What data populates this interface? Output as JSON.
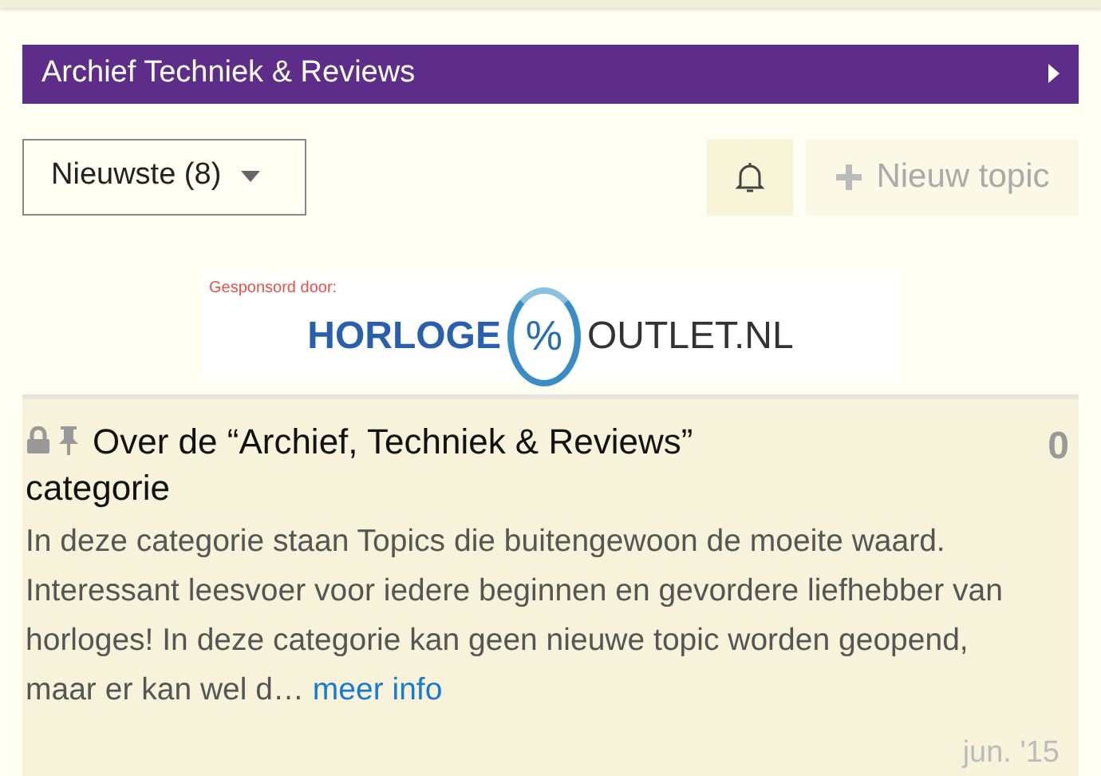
{
  "category_bar": {
    "title": "Archief Techniek & Reviews"
  },
  "toolbar": {
    "sort_dropdown": {
      "label": "Nieuwste (8)"
    },
    "new_topic_button": {
      "label": "Nieuw topic",
      "disabled": true
    }
  },
  "sponsor_banner": {
    "caption": "Gesponsord door:",
    "logo_left": "HORLOGE",
    "logo_symbol": "%",
    "logo_right": "OUTLET.NL"
  },
  "topics": [
    {
      "title": "Over de “Archief, Techniek & Reviews” categorie",
      "closed": true,
      "pinned": true,
      "replies": "0",
      "excerpt": "In deze categorie staan Topics die buitengewoon de moeite waard. Interessant leesvoer voor iedere beginnen en gevordere liefhebber van horloges! In deze categorie kan geen nieuwe topic worden geopend, maar er kan wel d…",
      "more_link": "meer info",
      "date": "jun. '15"
    }
  ]
}
